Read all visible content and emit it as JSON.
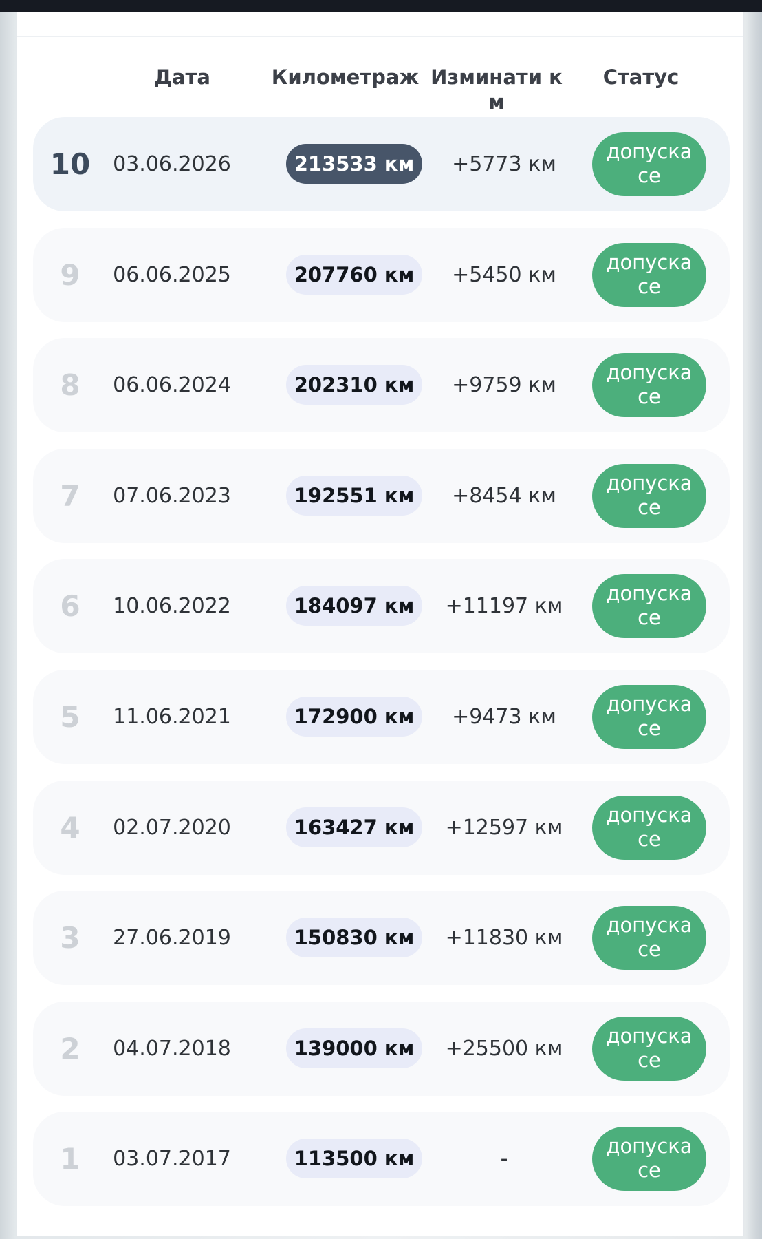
{
  "table": {
    "headers": {
      "date": "Дата",
      "km": "Километраж",
      "diff_line1": "Изминати к",
      "diff_line2": "м",
      "status": "Статус"
    },
    "rows": [
      {
        "index": "10",
        "date": "03.06.2026",
        "km": "213533 км",
        "diff": "+5773 км",
        "status_line1": "допуска",
        "status_line2": "се"
      },
      {
        "index": "9",
        "date": "06.06.2025",
        "km": "207760 км",
        "diff": "+5450 км",
        "status_line1": "допуска",
        "status_line2": "се"
      },
      {
        "index": "8",
        "date": "06.06.2024",
        "km": "202310 км",
        "diff": "+9759 км",
        "status_line1": "допуска",
        "status_line2": "се"
      },
      {
        "index": "7",
        "date": "07.06.2023",
        "km": "192551 км",
        "diff": "+8454 км",
        "status_line1": "допуска",
        "status_line2": "се"
      },
      {
        "index": "6",
        "date": "10.06.2022",
        "km": "184097 км",
        "diff": "+11197 км",
        "status_line1": "допуска",
        "status_line2": "се"
      },
      {
        "index": "5",
        "date": "11.06.2021",
        "km": "172900 км",
        "diff": "+9473 км",
        "status_line1": "допуска",
        "status_line2": "се"
      },
      {
        "index": "4",
        "date": "02.07.2020",
        "km": "163427 км",
        "diff": "+12597 км",
        "status_line1": "допуска",
        "status_line2": "се"
      },
      {
        "index": "3",
        "date": "27.06.2019",
        "km": "150830 км",
        "diff": "+11830 км",
        "status_line1": "допуска",
        "status_line2": "се"
      },
      {
        "index": "2",
        "date": "04.07.2018",
        "km": "139000 км",
        "diff": "+25500 км",
        "status_line1": "допуска",
        "status_line2": "се"
      },
      {
        "index": "1",
        "date": "03.07.2017",
        "km": "113500 км",
        "diff": "-",
        "status_line1": "допуска",
        "status_line2": "се"
      }
    ]
  },
  "colors": {
    "status_badge": "#4caf7c",
    "latest_km_pill": "#475569",
    "km_pill": "#e8ebf8",
    "latest_row": "#eff3f8"
  }
}
